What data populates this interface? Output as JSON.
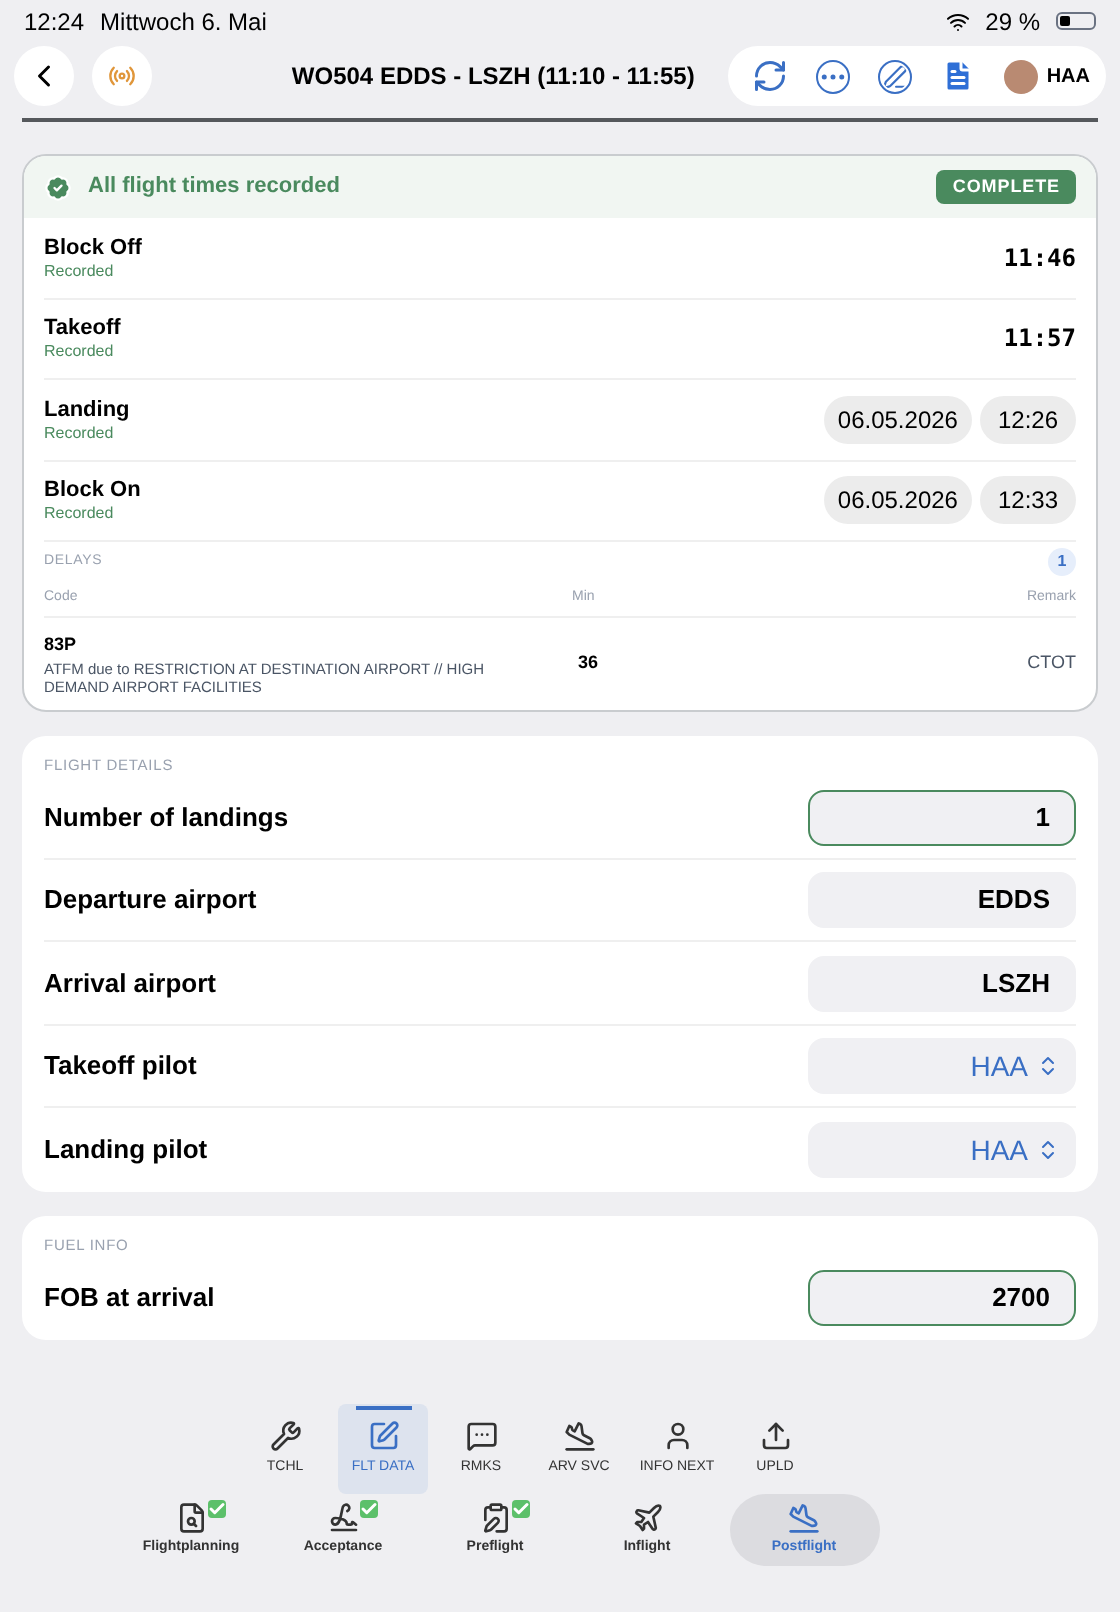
{
  "status_bar": {
    "time": "12:24",
    "date": "Mittwoch 6. Mai",
    "battery": "29 %"
  },
  "header": {
    "title": "WO504 EDDS - LSZH (11:10 - 11:55)",
    "user": "HAA"
  },
  "flight_times": {
    "status_text": "All flight times recorded",
    "badge": "COMPLETE",
    "rows": [
      {
        "kind": "plain",
        "label": "Block Off",
        "status": "Recorded",
        "time": "11:46"
      },
      {
        "kind": "plain",
        "label": "Takeoff",
        "status": "Recorded",
        "time": "11:57"
      },
      {
        "kind": "date",
        "label": "Landing",
        "status": "Recorded",
        "date": "06.05.2026",
        "time": "12:26"
      },
      {
        "kind": "date",
        "label": "Block On",
        "status": "Recorded",
        "date": "06.05.2026",
        "time": "12:33"
      }
    ]
  },
  "delays": {
    "title": "DELAYS",
    "count": "1",
    "columns": [
      "Code",
      "Min",
      "Remark"
    ],
    "rows": [
      {
        "code": "83P",
        "description": "ATFM due to RESTRICTION AT DESTINATION AIRPORT // HIGH DEMAND AIRPORT FACILITIES",
        "min": "36",
        "remark": "CTOT"
      }
    ]
  },
  "flight_details": {
    "title": "FLIGHT DETAILS",
    "fields": [
      {
        "kind": "input",
        "label": "Number of landings",
        "value": "1",
        "focused": true
      },
      {
        "kind": "input",
        "label": "Departure airport",
        "value": "EDDS",
        "focused": false
      },
      {
        "kind": "input",
        "label": "Arrival airport",
        "value": "LSZH",
        "focused": false
      },
      {
        "kind": "picker",
        "label": "Takeoff pilot",
        "value": "HAA"
      },
      {
        "kind": "picker",
        "label": "Landing pilot",
        "value": "HAA"
      }
    ]
  },
  "fuel_info": {
    "title": "FUEL INFO",
    "fields": [
      {
        "kind": "input",
        "label": "FOB at arrival",
        "value": "2700",
        "focused": true
      }
    ]
  },
  "toolbar": [
    {
      "kind": "tools",
      "label": "TCHL",
      "selected": false
    },
    {
      "kind": "edit",
      "label": "FLT DATA",
      "selected": true
    },
    {
      "kind": "remarks",
      "label": "RMKS",
      "selected": false
    },
    {
      "kind": "arrival",
      "label": "ARV SVC",
      "selected": false
    },
    {
      "kind": "person",
      "label": "INFO NEXT",
      "selected": false
    },
    {
      "kind": "upload",
      "label": "UPLD",
      "selected": false
    }
  ],
  "phases": [
    {
      "kind": "plan",
      "label": "Flightplanning",
      "done": true,
      "selected": false
    },
    {
      "kind": "sign",
      "label": "Acceptance",
      "done": true,
      "selected": false
    },
    {
      "kind": "clipboard",
      "label": "Preflight",
      "done": true,
      "selected": false
    },
    {
      "kind": "cruise",
      "label": "Inflight",
      "done": false,
      "selected": false
    },
    {
      "kind": "arrival",
      "label": "Postflight",
      "done": false,
      "selected": true
    }
  ]
}
